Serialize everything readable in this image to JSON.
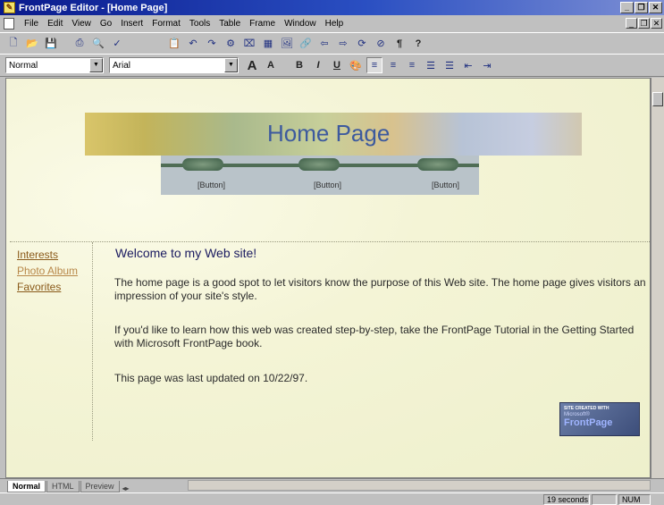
{
  "window": {
    "title": "FrontPage Editor - [Home Page]"
  },
  "menu": [
    "File",
    "Edit",
    "View",
    "Go",
    "Insert",
    "Format",
    "Tools",
    "Table",
    "Frame",
    "Window",
    "Help"
  ],
  "format_toolbar": {
    "style": "Normal",
    "font": "Arial"
  },
  "page": {
    "banner_title": "Home Page",
    "nav_buttons": [
      "[Button]",
      "[Button]",
      "[Button]"
    ],
    "sidebar_links": [
      "Interests",
      "Photo Album",
      "Favorites"
    ],
    "welcome": "Welcome to my Web site!",
    "para1": "The home page is a good spot to let visitors know the purpose of this Web site. The home page gives visitors an impression of your site's style.",
    "para2": "If you'd like to learn how this web was created step-by-step, take the FrontPage Tutorial in the Getting Started with Microsoft FrontPage book.",
    "updated": "This page was last updated on 10/22/97.",
    "badge": {
      "line1": "SITE CREATED WITH",
      "line2": "Microsoft®",
      "line3": "FrontPage"
    }
  },
  "view_tabs": [
    "Normal",
    "HTML",
    "Preview"
  ],
  "status": {
    "time": "19 seconds",
    "num": "NUM"
  },
  "colors": {
    "link_visited": "#a87b3a",
    "link": "#8a5a1a",
    "title_bar": "#0a1a8c",
    "banner_text": "#3d5a9e"
  }
}
